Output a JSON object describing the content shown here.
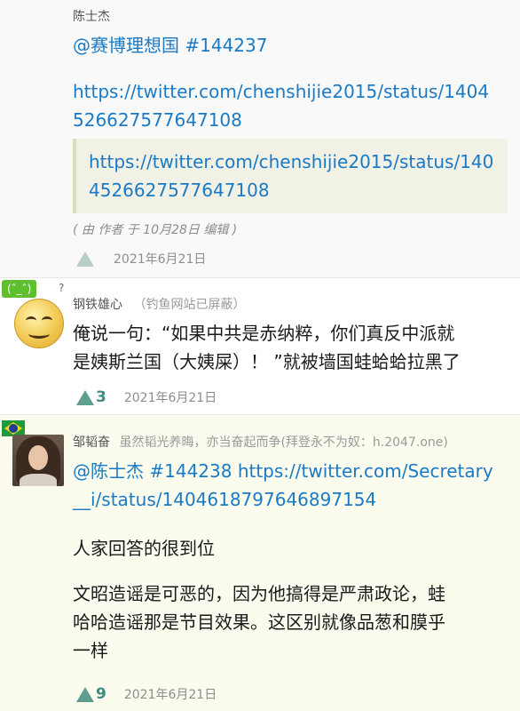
{
  "colors": {
    "link": "#1a7ac6",
    "vote": "#3f8c80",
    "highlight_bg": "#fbfbee"
  },
  "post1": {
    "author": "陈士杰",
    "line1_mention": "@赛博理想国",
    "line1_id": "#144237",
    "url_line1": "https://twitter.com/chenshijie2015/status/1404",
    "url_line2": "526627577647108",
    "quote_line1": "https://twitter.com/chenshijie2015/status/140",
    "quote_line2": "4526627577647108",
    "edited": "( 由 作者 于 10月28日 编辑 )",
    "votes": "",
    "date": "2021年6月21日"
  },
  "post2": {
    "avatar_bubble": "(ˆ_ˆ)",
    "avatar_bubble_mark": "?",
    "author": "钢铁雄心",
    "author_note": "（钓鱼网站已屏蔽）",
    "line1": "俺说一句：“如果中共是赤纳粹，你们真反中派就",
    "line2": "是姨斯兰国（大姨屎）！ ”就被墙国蛙蛤蛤拉黑了",
    "votes": "3",
    "date": "2021年6月21日"
  },
  "post3": {
    "author": "邹韬奋",
    "author_note": "虽然韬光养晦，亦当奋起而争(拜登永不为奴：h.2047.one)",
    "line1_mention": "@陈士杰",
    "line1_rest": "#144238 https://twitter.com/Secretary",
    "line2": "__i/status/1404618797646897154",
    "para1": "人家回答的很到位",
    "para2_line1": "文昭造谣是可恶的，因为他搞得是严肃政论，蛙",
    "para2_line2": "哈哈造谣那是节目效果。这区别就像品葱和膜乎",
    "para2_line3": "一样",
    "votes": "9",
    "date": "2021年6月21日"
  }
}
